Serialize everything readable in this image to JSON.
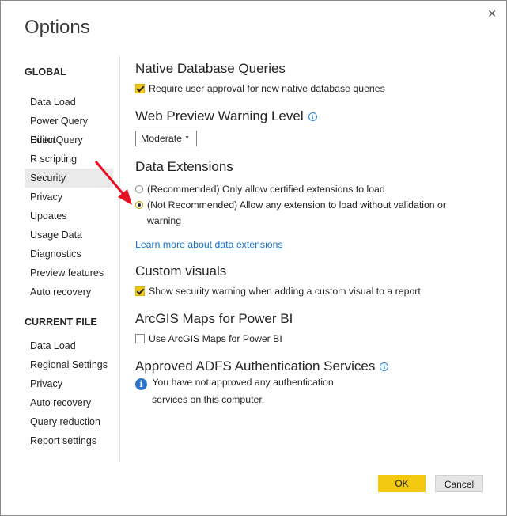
{
  "dialog": {
    "title": "Options",
    "close_glyph": "✕"
  },
  "nav": {
    "global_heading": "GLOBAL",
    "global_items": [
      "Data Load",
      "Power Query Editor",
      "DirectQuery",
      "R scripting",
      "Security",
      "Privacy",
      "Updates",
      "Usage Data",
      "Diagnostics",
      "Preview features",
      "Auto recovery"
    ],
    "active_item": "Security",
    "current_file_heading": "CURRENT FILE",
    "current_file_items": [
      "Data Load",
      "Regional Settings",
      "Privacy",
      "Auto recovery",
      "Query reduction",
      "Report settings"
    ]
  },
  "native_db": {
    "title": "Native Database Queries",
    "require_approval_label": "Require user approval for new native database queries",
    "require_approval_checked": true
  },
  "web_preview": {
    "title": "Web Preview Warning Level",
    "info_icon": "info-icon",
    "selected": "Moderate"
  },
  "data_extensions": {
    "title": "Data Extensions",
    "option_recommended": "(Recommended) Only allow certified extensions to load",
    "option_not_recommended_line1": "(Not Recommended) Allow any extension to load without validation or",
    "option_not_recommended_line2": "warning",
    "selected": "not_recommended",
    "learn_more_link": "Learn more about data extensions"
  },
  "custom_visuals": {
    "title": "Custom visuals",
    "show_warning_label": "Show security warning when adding a custom visual to a report",
    "show_warning_checked": true
  },
  "arcgis": {
    "title": "ArcGIS Maps for Power BI",
    "use_label": "Use ArcGIS Maps for Power BI",
    "use_checked": false
  },
  "adfs": {
    "title": "Approved ADFS Authentication Services",
    "message_line1": "You have not approved any authentication",
    "message_line2": "services on this computer."
  },
  "buttons": {
    "ok": "OK",
    "cancel": "Cancel"
  },
  "colors": {
    "accent_yellow": "#f2c811",
    "link_blue": "#1a6fc0",
    "arrow_red": "#e81123"
  }
}
